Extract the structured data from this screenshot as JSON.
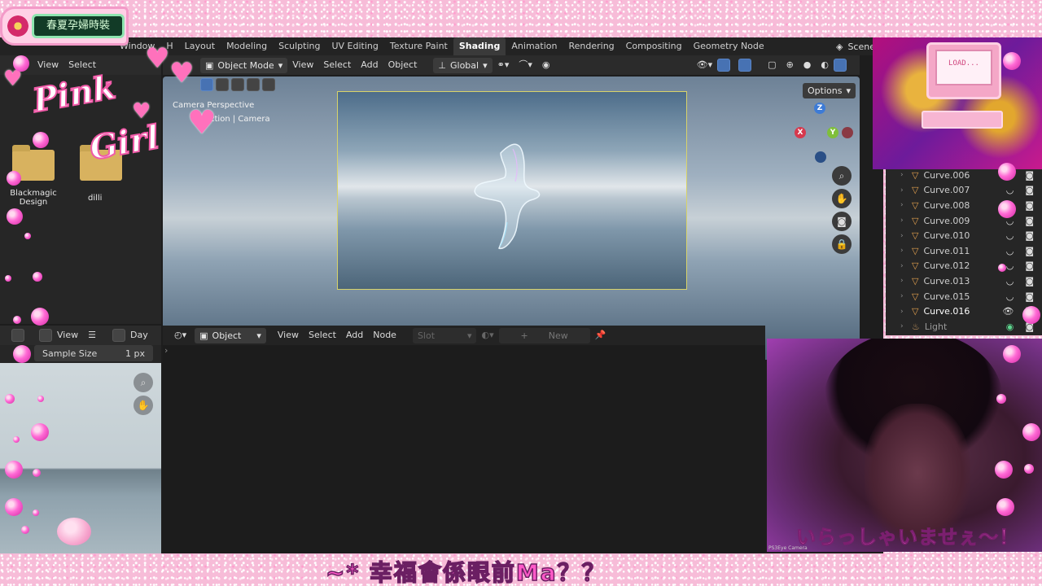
{
  "badge": {
    "text": "春夏孕婦時裝"
  },
  "menus": {
    "window": "Window",
    "help": "H"
  },
  "workspaces": [
    "Layout",
    "Modeling",
    "Sculpting",
    "UV Editing",
    "Texture Paint",
    "Shading",
    "Animation",
    "Rendering",
    "Compositing",
    "Geometry Node"
  ],
  "active_workspace": "Shading",
  "scene_label": "Scene",
  "file_browser": {
    "view": "View",
    "select": "Select",
    "folders": [
      {
        "label": "Blackmagic Design"
      },
      {
        "label": "dilli"
      }
    ]
  },
  "viewport": {
    "mode": "Object Mode",
    "menu": [
      "View",
      "Select",
      "Add",
      "Object"
    ],
    "transform": "Global",
    "options": "Options",
    "overlay_line1": "Camera Perspective",
    "overlay_line2": "ction | Camera",
    "gizmo": {
      "z": "Z",
      "y": "Y",
      "x": "X"
    }
  },
  "image_editor": {
    "view": "View",
    "day": "Day",
    "sample_size_label": "Sample Size",
    "sample_size_value": "1 px"
  },
  "node_editor": {
    "type": "Object",
    "menu": [
      "View",
      "Select",
      "Add",
      "Node"
    ],
    "slot": "Slot",
    "new_label": "New"
  },
  "outliner": {
    "rows": [
      {
        "name": "Curve.006",
        "type": "curve"
      },
      {
        "name": "Curve.007",
        "type": "curve"
      },
      {
        "name": "Curve.008",
        "type": "curve"
      },
      {
        "name": "Curve.009",
        "type": "curve"
      },
      {
        "name": "Curve.010",
        "type": "curve"
      },
      {
        "name": "Curve.011",
        "type": "curve"
      },
      {
        "name": "Curve.012",
        "type": "curve"
      },
      {
        "name": "Curve.013",
        "type": "curve"
      },
      {
        "name": "Curve.015",
        "type": "curve"
      },
      {
        "name": "Curve.016",
        "type": "curve",
        "selected": true
      },
      {
        "name": "Light",
        "type": "light"
      }
    ]
  },
  "overlay": {
    "logo_line1": "Pink",
    "logo_line2": "Girl",
    "pc_screen": "LOAD...",
    "webcam_caption": "いらっしゃいませぇ〜！",
    "webcam_label": "PS3Eye Camera",
    "bottom_banner": "~* 幸福會係眼前Ma？？"
  },
  "colors": {
    "accent_pink": "#ff59c8",
    "blender_bg": "#1d1d1d",
    "active_blue": "#4772b3",
    "camera_frame": "#d8d36a"
  }
}
